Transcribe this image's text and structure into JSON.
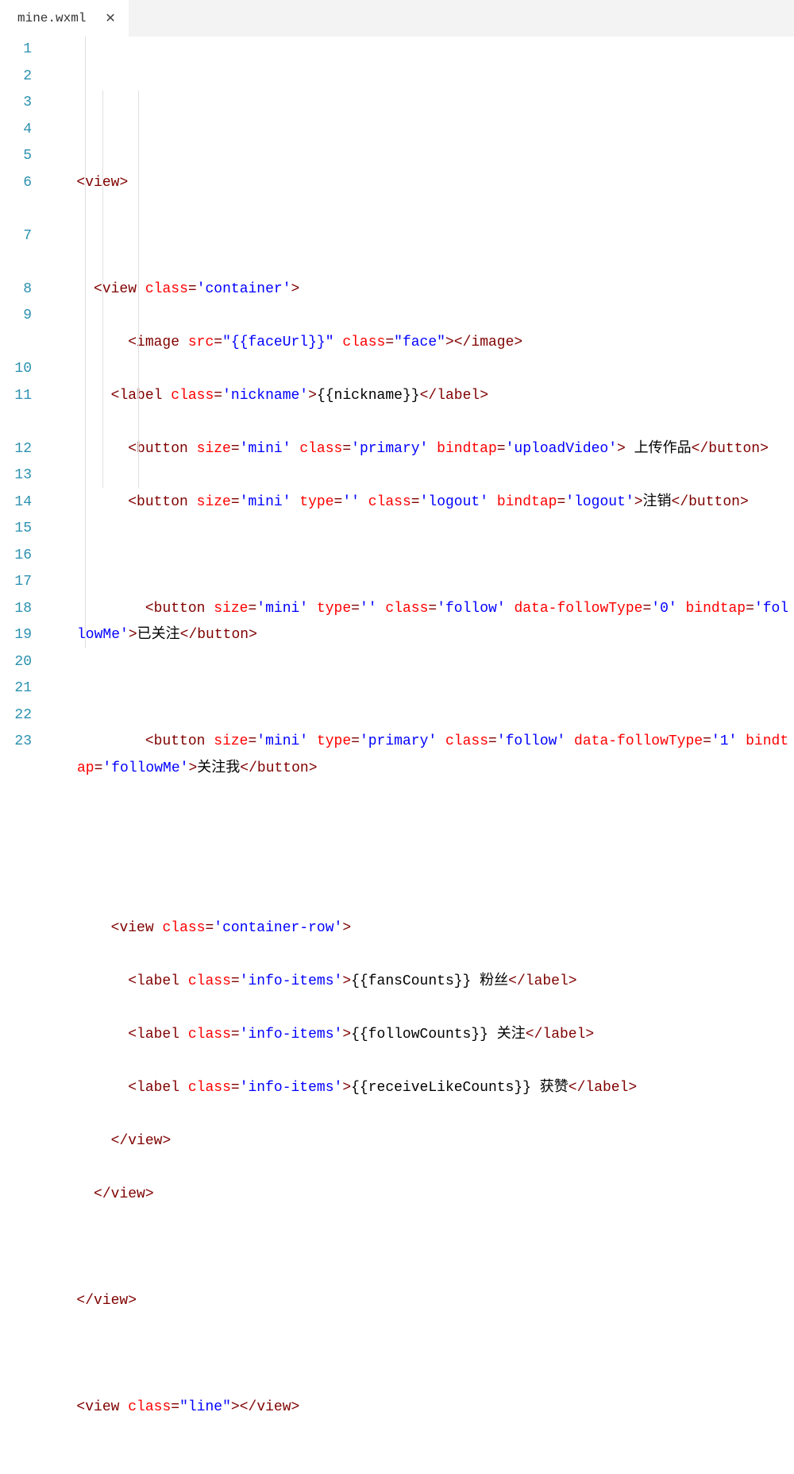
{
  "tab": {
    "filename": "mine.wxml",
    "close_glyph": "✕"
  },
  "gutter": {
    "l1": "1",
    "l2": "2",
    "l3": "3",
    "l4": "4",
    "l5": "5",
    "l6": "6",
    "l7": "7",
    "l8": "8",
    "l9": "9",
    "l10": "10",
    "l11": "11",
    "l12": "12",
    "l13": "13",
    "l14": "14",
    "l15": "15",
    "l16": "16",
    "l17": "17",
    "l18": "18",
    "l19": "19",
    "l20": "20",
    "l21": "21",
    "l22": "22",
    "l23": "23"
  },
  "tokens": {
    "open": "<",
    "close": ">",
    "slash": "/",
    "eq": "=",
    "view": "view",
    "image": "image",
    "label": "label",
    "button": "button",
    "class": "class",
    "src": "src",
    "size": "size",
    "type": "type",
    "bindtap": "bindtap",
    "data_followType": "data-followType",
    "val_container": "'container'",
    "val_faceUrl": "\"{{faceUrl}}\"",
    "val_face": "\"face\"",
    "val_nickname": "'nickname'",
    "txt_nickname": "{{nickname}}",
    "val_mini": "'mini'",
    "val_primary": "'primary'",
    "val_uploadVideo": "'uploadVideo'",
    "txt_uploadVideo": " 上传作品",
    "val_empty": "''",
    "val_logout": "'logout'",
    "txt_logout": "注销",
    "val_follow": "'follow'",
    "val_followType0": "'0'",
    "val_followMe": "'followMe'",
    "txt_followed": "已关注",
    "val_followType1": "'1'",
    "txt_followMe": "关注我",
    "val_containerRow": "'container-row'",
    "val_infoItems": "'info-items'",
    "txt_fans": "{{fansCounts}} 粉丝",
    "txt_follow": "{{followCounts}} 关注",
    "txt_like": "{{receiveLikeCounts}} 获赞",
    "val_line": "\"line\""
  }
}
